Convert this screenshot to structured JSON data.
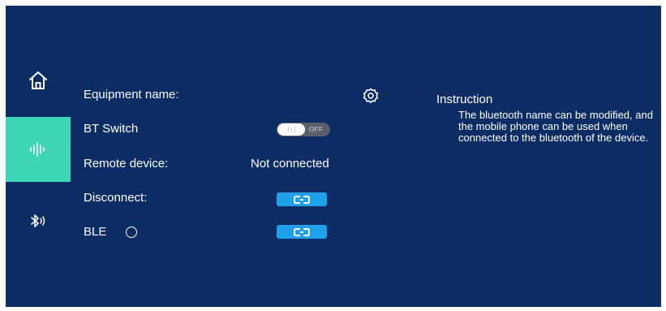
{
  "sidebar": {
    "items": [
      {
        "icon": "home-icon",
        "active": false
      },
      {
        "icon": "audio-wave-icon",
        "active": true
      },
      {
        "icon": "bluetooth-audio-icon",
        "active": false
      }
    ]
  },
  "settings": {
    "equipment_name_label": "Equipment name:",
    "bt_switch_label": "BT Switch",
    "bt_switch_state": "OFF",
    "remote_device_label": "Remote device:",
    "remote_device_value": "Not connected",
    "disconnect_label": "Disconnect:",
    "ble_label": "BLE"
  },
  "instruction": {
    "title": "Instruction",
    "body": "The bluetooth name can be modified, and the mobile phone can be used when connected to the bluetooth of the device."
  },
  "colors": {
    "background": "#0b2d63",
    "active_tab": "#3ed6b6",
    "button": "#1ea0ea",
    "toggle_off": "#5a5f6a"
  }
}
